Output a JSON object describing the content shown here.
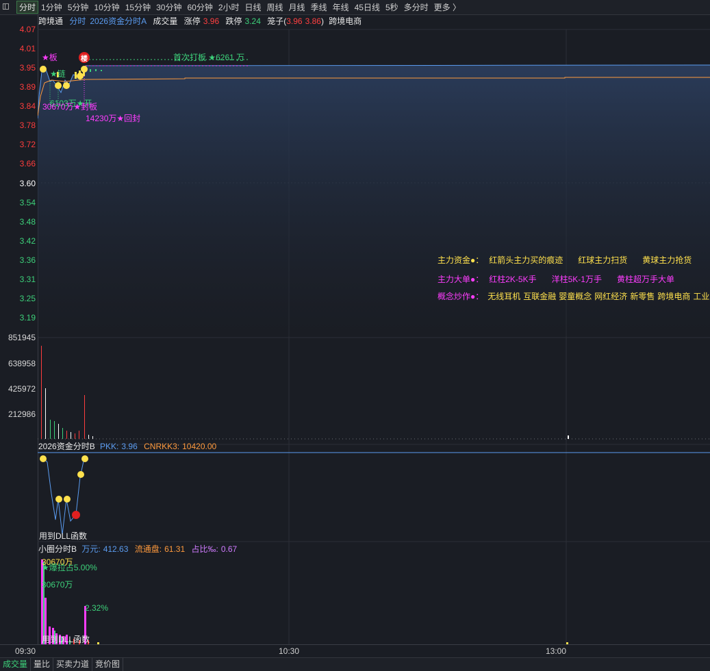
{
  "toolbar": {
    "periods": [
      "分时",
      "1分钟",
      "5分钟",
      "10分钟",
      "15分钟",
      "30分钟",
      "60分钟",
      "2小时",
      "日线",
      "周线",
      "月线",
      "季线",
      "年线",
      "45日线",
      "5秒",
      "多分时",
      "更多 〉"
    ]
  },
  "price_axis": {
    "up_labels": [
      "4.07",
      "4.01",
      "3.95",
      "3.89",
      "3.84",
      "3.78",
      "3.72",
      "3.66"
    ],
    "mid_label": "3.60",
    "down_labels": [
      "3.54",
      "3.48",
      "3.42",
      "3.36",
      "3.31",
      "3.25",
      "3.19"
    ]
  },
  "volume_axis": [
    "851945",
    "638958",
    "425972",
    "212986"
  ],
  "main_header": {
    "stock": "跨境通",
    "mode": "分时",
    "indicator": "2026资金分时A",
    "volume": "成交量",
    "limit_up_label": "涨停",
    "limit_up_value": "3.96",
    "limit_down_label": "跌停",
    "limit_down_value": "3.24",
    "cage_label": "笼子(",
    "cage_low": "3.96",
    "cage_high": "3.86",
    "cage_close": ")",
    "concept": "跨境电商"
  },
  "annotations": {
    "board": "★板",
    "lou": "楼",
    "first_board": "首次打板 ★6261 万",
    "link": "★链",
    "amt1": "6103万★开",
    "amt2": "30670万★封板",
    "reseal": "14230万★回封"
  },
  "legend": {
    "row1_title": "主力资金●：",
    "row1_items": [
      "红箭头主力买的痕迹",
      "红球主力扫货",
      "黄球主力抢货"
    ],
    "row2_title": "主力大单●：",
    "row2_items": [
      "红柱2K-5K手",
      "洋柱5K-1万手",
      "黄柱超万手大单"
    ],
    "row3_title": "概念炒作●：",
    "row3_items": [
      "无线耳机",
      "互联金融",
      "婴童概念",
      "网红经济",
      "新零售",
      "跨境电商",
      "工业大"
    ]
  },
  "panel_b": {
    "title": "2026资金分时B",
    "pkk_label": "PKK:",
    "pkk_value": "3.96",
    "cnrkk_label": "CNRKK3:",
    "cnrkk_value": "10420.00",
    "footer": "用到DLL函数"
  },
  "panel_c": {
    "title": "小圈分时B",
    "wan_label": "万元:",
    "wan_value": "412.63",
    "float_label": "流通盘:",
    "float_value": "61.31",
    "ratio_label": "占比‰:",
    "ratio_value": "0.67",
    "amt_a": "30670万",
    "pull": "★爆拉占5.00%",
    "amt_b": "30670万",
    "pct": "2.32%",
    "footer": "用到DLL函数"
  },
  "time_axis": [
    "09:30",
    "10:30",
    "13:00"
  ],
  "bottom_tabs": [
    "成交量",
    "量比",
    "买卖力道",
    "竞价图"
  ],
  "colors": {
    "background": "#1a1d24",
    "up": "#ff3d3d",
    "down": "#3dd17a",
    "price_line": "#5b9cf0",
    "avg_line": "#ff9a3d",
    "marker": "#ffe14d",
    "signal": "#ff3dff"
  }
}
